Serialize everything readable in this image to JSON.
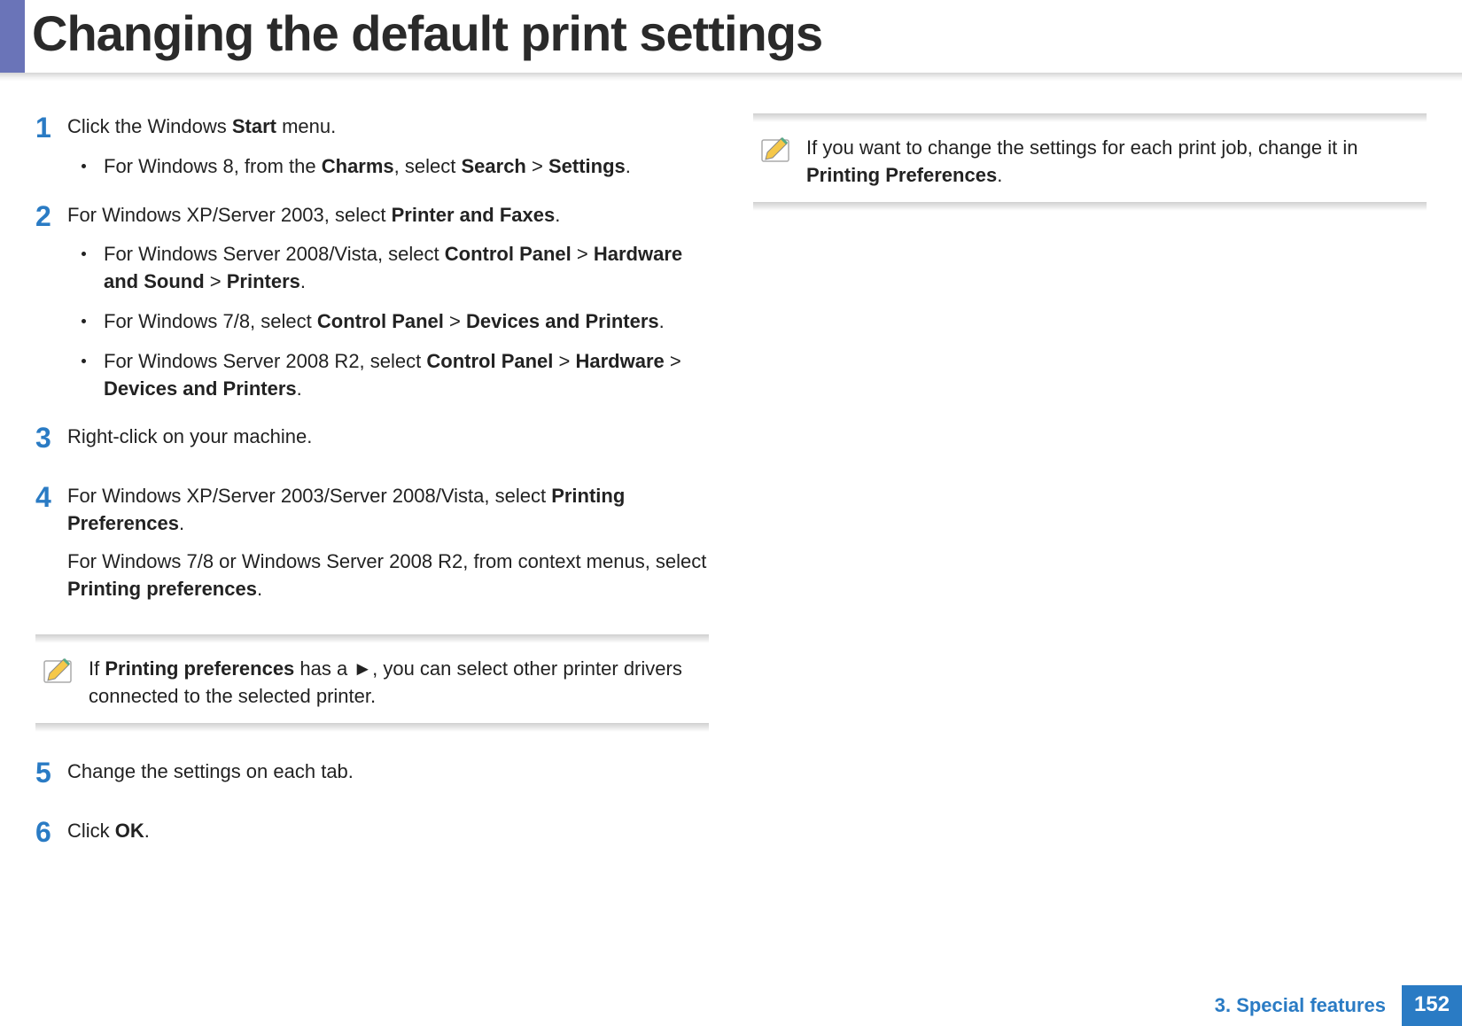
{
  "header": {
    "title": "Changing the default print settings"
  },
  "steps": {
    "s1": {
      "num": "1",
      "text_pre": "Click the Windows ",
      "text_b1": "Start",
      "text_post": " menu.",
      "bullets": {
        "b1_pre": "For Windows 8, from the ",
        "b1_bold1": "Charms",
        "b1_mid1": ", select ",
        "b1_bold2": "Search",
        "b1_mid2": " > ",
        "b1_bold3": "Settings",
        "b1_post": "."
      }
    },
    "s2": {
      "num": "2",
      "text_pre": "For Windows XP/Server 2003, select ",
      "text_b1": "Printer and Faxes",
      "text_post": ".",
      "bullets": {
        "b1_pre": "For Windows Server 2008/Vista, select ",
        "b1_bold1": "Control Panel",
        "b1_mid1": " > ",
        "b1_bold2": "Hardware and Sound",
        "b1_mid2": " > ",
        "b1_bold3": "Printers",
        "b1_post": ".",
        "b2_pre": "For Windows 7/8, select ",
        "b2_bold1": "Control Panel",
        "b2_mid1": " > ",
        "b2_bold2": "Devices and Printers",
        "b2_post": ".",
        "b3_pre": "For Windows Server 2008 R2, select ",
        "b3_bold1": "Control Panel",
        "b3_mid1": " > ",
        "b3_bold2": "Hardware",
        "b3_mid2": " > ",
        "b3_bold3": "Devices and Printers",
        "b3_post": "."
      }
    },
    "s3": {
      "num": "3",
      "text": "Right-click on your machine."
    },
    "s4": {
      "num": "4",
      "line1_pre": "For Windows XP/Server 2003/Server 2008/Vista, select ",
      "line1_bold": "Printing Preferences",
      "line1_post": ".",
      "line2_pre": "For Windows 7/8 or Windows Server 2008 R2, from context menus, select ",
      "line2_bold": "Printing preferences",
      "line2_post": "."
    },
    "s5": {
      "num": "5",
      "text": "Change the settings on each tab."
    },
    "s6": {
      "num": "6",
      "text_pre": "Click ",
      "text_bold": "OK",
      "text_post": "."
    }
  },
  "notes": {
    "n1_pre": "If ",
    "n1_bold": "Printing preferences",
    "n1_mid": " has a ►, you can select other printer drivers connected to the selected printer.",
    "n2_pre": "If you want to change the settings for each print job, change it in ",
    "n2_bold": "Printing Preferences",
    "n2_post": "."
  },
  "footer": {
    "chapter": "3.  Special features",
    "page": "152"
  }
}
